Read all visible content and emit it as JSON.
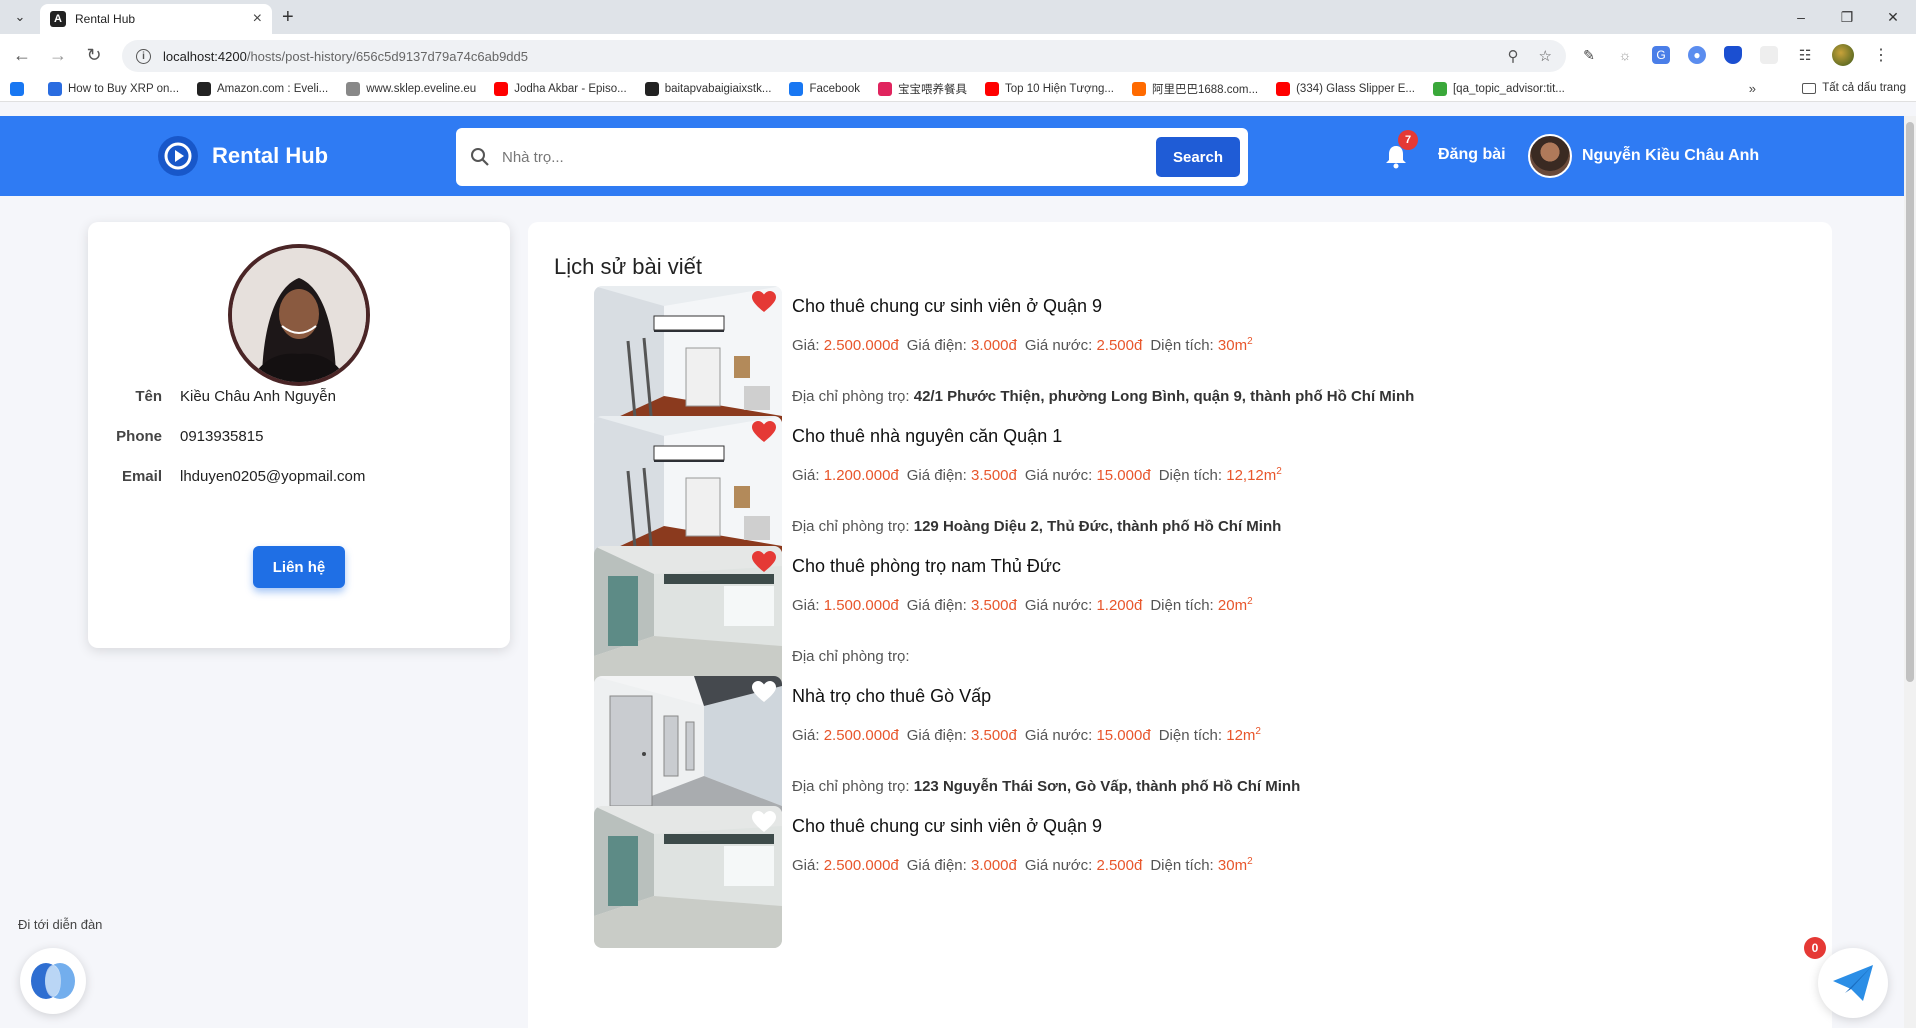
{
  "browser": {
    "tab_title": "Rental Hub",
    "url_host": "localhost:4200",
    "url_path": "/hosts/post-history/656c5d9137d79a74c6ab9dd5",
    "bookmarks": [
      {
        "label": "",
        "color": "#1877f2",
        "icon": "facebook-icon"
      },
      {
        "label": "How to Buy XRP on...",
        "color": "#2a6ce0",
        "icon": "xrp-icon"
      },
      {
        "label": "Amazon.com : Eveli...",
        "color": "#222222",
        "icon": "amazon-icon"
      },
      {
        "label": "www.sklep.eveline.eu",
        "color": "#888888",
        "icon": "page-icon"
      },
      {
        "label": "Jodha Akbar - Episo...",
        "color": "#ff0000",
        "icon": "youtube-icon"
      },
      {
        "label": "baitapvabaigiaixstk...",
        "color": "#222222",
        "icon": "globe-icon"
      },
      {
        "label": "Facebook",
        "color": "#1877f2",
        "icon": "facebook-icon"
      },
      {
        "label": "宝宝喂养餐具",
        "color": "#e0245e",
        "icon": "shop-icon"
      },
      {
        "label": "Top 10 Hiện Tượng...",
        "color": "#ff0000",
        "icon": "youtube-icon"
      },
      {
        "label": "阿里巴巴1688.com...",
        "color": "#ff6a00",
        "icon": "alibaba-icon"
      },
      {
        "label": "(334) Glass Slipper E...",
        "color": "#ff0000",
        "icon": "youtube-icon"
      },
      {
        "label": "[qa_topic_advisor:tit...",
        "color": "#3aa83a",
        "icon": "cx-icon"
      }
    ],
    "all_bookmarks": "Tất cả dấu trang"
  },
  "header": {
    "brand": "Rental Hub",
    "search_placeholder": "Nhà trọ...",
    "search_button": "Search",
    "notification_count": "7",
    "post_link": "Đăng bài",
    "user_name": "Nguyễn Kiều Châu Anh",
    "brand_color": "#2f7bf3"
  },
  "profile": {
    "name_label": "Tên",
    "name_value": "Kiều Châu Anh Nguyễn",
    "phone_label": "Phone",
    "phone_value": "0913935815",
    "email_label": "Email",
    "email_value": "lhduyen0205@yopmail.com",
    "contact_button": "Liên hệ"
  },
  "history": {
    "title": "Lịch sử bài viết",
    "labels": {
      "price": "Giá:",
      "electric": "Giá điện:",
      "water": "Giá nước:",
      "area": "Diện tích:",
      "address": "Địa chỉ phòng trọ:"
    },
    "posts": [
      {
        "title": "Cho thuê chung cư sinh viên ở Quận 9",
        "price": "2.500.000đ",
        "electric": "3.000đ",
        "water": "2.500đ",
        "area": "30m",
        "address": "42/1 Phước Thiện, phường Long Bình, quận 9, thành phố Hồ Chí Minh",
        "favorite": true,
        "image": "loft-room"
      },
      {
        "title": "Cho thuê nhà nguyên căn Quận 1",
        "price": "1.200.000đ",
        "electric": "3.500đ",
        "water": "15.000đ",
        "area": "12,12m",
        "address": "129 Hoàng Diệu 2, Thủ Đức, thành phố Hồ Chí Minh",
        "favorite": true,
        "image": "loft-room"
      },
      {
        "title": "Cho thuê phòng trọ nam Thủ Đức",
        "price": "1.500.000đ",
        "electric": "3.500đ",
        "water": "1.200đ",
        "area": "20m",
        "address": "",
        "favorite": true,
        "image": "empty-room"
      },
      {
        "title": "Nhà trọ cho thuê Gò Vấp",
        "price": "2.500.000đ",
        "electric": "3.500đ",
        "water": "15.000đ",
        "area": "12m",
        "address": "123 Nguyễn Thái Sơn, Gò Vấp, thành phố Hồ Chí Minh",
        "favorite": false,
        "image": "corridor"
      },
      {
        "title": "Cho thuê chung cư sinh viên ở Quận 9",
        "price": "2.500.000đ",
        "electric": "3.000đ",
        "water": "2.500đ",
        "area": "30m",
        "address": "",
        "favorite": false,
        "image": "empty-room"
      }
    ]
  },
  "floating": {
    "forum_label": "Đi tới diễn đàn",
    "chat_count": "0"
  }
}
